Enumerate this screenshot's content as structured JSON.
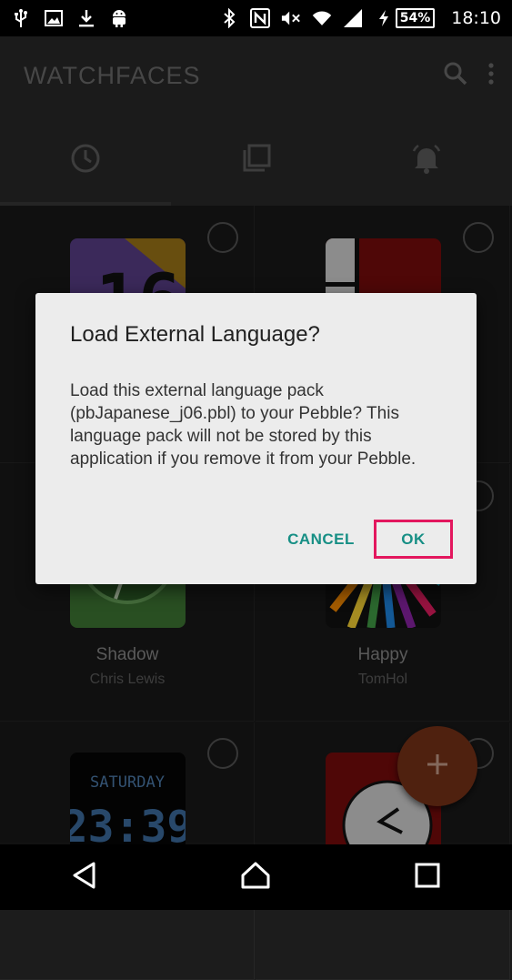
{
  "status_bar": {
    "battery": "54%",
    "time": "18:10",
    "left_icons": [
      "usb-icon",
      "image-icon",
      "download-icon",
      "android-icon"
    ],
    "right_icons": [
      "bluetooth-icon",
      "nfc-icon",
      "mute-icon",
      "wifi-icon",
      "signal-icon",
      "charging-icon"
    ]
  },
  "app_bar": {
    "title": "WATCHFACES",
    "actions": [
      "search-icon",
      "more-vert-icon"
    ]
  },
  "tabs": [
    {
      "icon": "clock-icon",
      "selected": true
    },
    {
      "icon": "apps-icon",
      "selected": false
    },
    {
      "icon": "notification-bell-icon",
      "selected": false
    }
  ],
  "watchfaces": [
    {
      "name": "",
      "author": ""
    },
    {
      "name": "",
      "author": ""
    },
    {
      "name": "Shadow",
      "author": "Chris Lewis"
    },
    {
      "name": "Happy",
      "author": "TomHol"
    },
    {
      "name": "",
      "author": "",
      "thumb_text_top": "SATURDAY",
      "thumb_text_main": "23:39"
    },
    {
      "name": "",
      "author": ""
    }
  ],
  "fab": {
    "icon": "plus-icon",
    "label": "+"
  },
  "dialog": {
    "title": "Load External Language?",
    "message": "Load this external language pack (pbJapanese_j06.pbl) to your Pebble? This language pack will not be stored by this application if you remove it from your Pebble.",
    "cancel_label": "CANCEL",
    "ok_label": "OK"
  },
  "nav_bar": [
    "back-icon",
    "home-icon",
    "recents-icon"
  ],
  "colors": {
    "accent": "#178f85",
    "highlight": "#e3175e",
    "fab": "#7a3318"
  }
}
